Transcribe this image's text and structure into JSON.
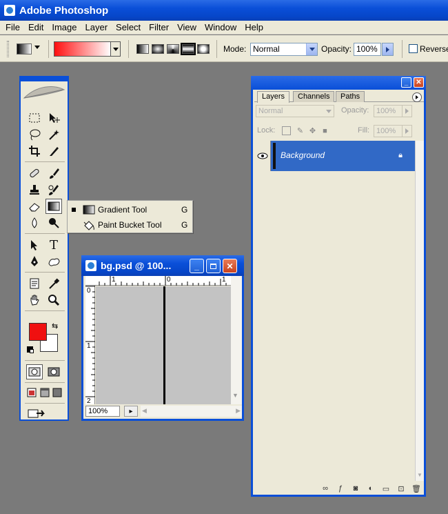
{
  "app": {
    "title": "Adobe Photoshop"
  },
  "menubar": {
    "items": [
      "File",
      "Edit",
      "Image",
      "Layer",
      "Select",
      "Filter",
      "View",
      "Window",
      "Help"
    ]
  },
  "options": {
    "gradient_colors": {
      "start": "#ff1010",
      "end": "#ffffff"
    },
    "mode_label": "Mode:",
    "mode_value": "Normal",
    "opacity_label": "Opacity:",
    "opacity_value": "100%",
    "reverse_label": "Reverse",
    "reverse_checked": false
  },
  "toolbox": {
    "foreground_color": "#f01010",
    "background_color": "#ffffff",
    "type_tool_glyph": "T"
  },
  "flyout": {
    "items": [
      {
        "name": "Gradient Tool",
        "shortcut": "G",
        "selected": true
      },
      {
        "name": "Paint Bucket Tool",
        "shortcut": "G",
        "selected": false
      }
    ]
  },
  "document": {
    "title": "bg.psd @ 100...",
    "zoom": "100%",
    "ruler_h": [
      "1",
      "0",
      "1"
    ],
    "ruler_v": [
      "0",
      "1",
      "2"
    ]
  },
  "layers_palette": {
    "tabs": [
      "Layers",
      "Channels",
      "Paths"
    ],
    "active_tab": "Layers",
    "blend_mode": "Normal",
    "opacity_label": "Opacity:",
    "opacity_value": "100%",
    "lock_label": "Lock:",
    "fill_label": "Fill:",
    "fill_value": "100%",
    "layers": [
      {
        "name": "Background",
        "locked": true,
        "visible": true
      }
    ]
  }
}
